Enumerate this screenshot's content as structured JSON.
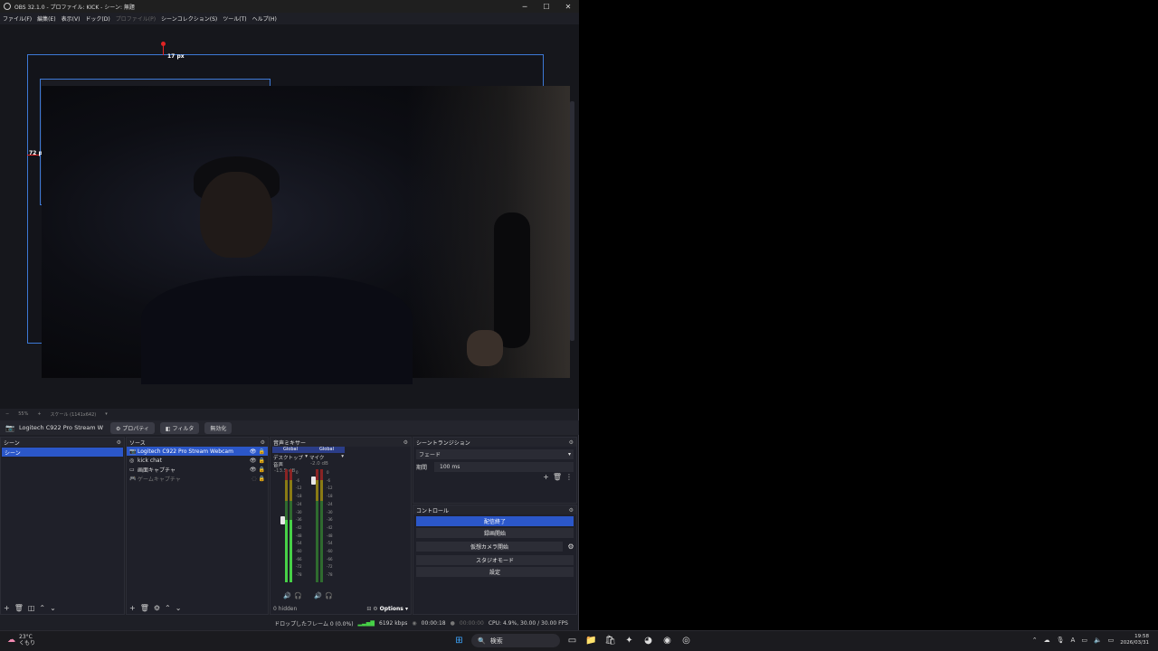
{
  "window": {
    "title": "OBS 32.1.0 - プロファイル: KICK - シーン: 無題",
    "min": "─",
    "max": "☐",
    "close": "✕"
  },
  "menu": [
    "ファイル(F)",
    "編集(E)",
    "表示(V)",
    "ドック(D)",
    "プロファイル(P)",
    "シーンコレクション(S)",
    "ツール(T)",
    "ヘルプ(H)"
  ],
  "preview": {
    "measure_top": "17 px",
    "measure_left": "72 px",
    "zoom": "55%",
    "scale_label": "スケール (1141x642)"
  },
  "source_toolbar": {
    "source_name": "Logitech C922 Pro Stream W",
    "properties": "プロパティ",
    "filters": "フィルタ",
    "disable": "無効化"
  },
  "scenes": {
    "title": "シーン",
    "items": [
      "シーン"
    ]
  },
  "sources": {
    "title": "ソース",
    "items": [
      {
        "icon": "📷",
        "name": "Logitech C922 Pro Stream Webcam",
        "visible": "👁",
        "lock": "🔒"
      },
      {
        "icon": "◎",
        "name": "kick chat",
        "visible": "👁",
        "lock": "🔒"
      },
      {
        "icon": "▭",
        "name": "画面キャプチャ",
        "visible": "👁",
        "lock": "🔒"
      },
      {
        "icon": "🎮",
        "name": "ゲームキャプチャ",
        "visible": "◌",
        "lock": "🔒"
      }
    ]
  },
  "mixer": {
    "title": "音声ミキサー",
    "channels": [
      {
        "global": "Global",
        "name": "デスクトップ音声",
        "db": "-13.5 dB",
        "level": 0.55
      },
      {
        "global": "Global",
        "name": "マイク",
        "db": "-2.0 dB",
        "level": 0.0
      }
    ],
    "scale": [
      "0",
      "-6",
      "-12",
      "-18",
      "-24",
      "-30",
      "-36",
      "-42",
      "-48",
      "-54",
      "-60",
      "-66",
      "-72",
      "-78"
    ],
    "hidden": "0 hidden",
    "options": "Options"
  },
  "transitions": {
    "title": "シーントランジション",
    "selected": "フェード",
    "duration_label": "期間",
    "duration": "100 ms"
  },
  "controls": {
    "title": "コントロール",
    "stop_stream": "配信終了",
    "start_record": "録画開始",
    "start_vcam": "仮想カメラ開始",
    "studio_mode": "スタジオモード",
    "settings": "設定"
  },
  "status": {
    "dropped": "ドロップしたフレーム 0 (0.0%)",
    "bitrate": "6192 kbps",
    "stream_time": "00:00:18",
    "record_time": "00:00:00",
    "cpu": "CPU: 4.9%, 30.00 / 30.00 FPS"
  },
  "taskbar": {
    "temp": "23°C",
    "weather": "くもり",
    "search": "検索",
    "time": "19:58",
    "date": "2026/03/31",
    "ime": "A"
  }
}
